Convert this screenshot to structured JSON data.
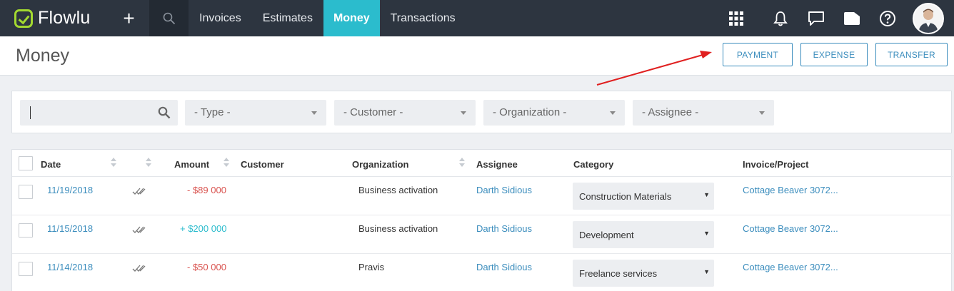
{
  "app": {
    "name": "Flowlu"
  },
  "nav": {
    "items": [
      {
        "label": "Invoices"
      },
      {
        "label": "Estimates"
      },
      {
        "label": "Money"
      },
      {
        "label": "Transactions"
      }
    ],
    "active": "Money"
  },
  "header": {
    "title": "Money",
    "buttons": {
      "payment": "PAYMENT",
      "expense": "EXPENSE",
      "transfer": "TRANSFER"
    }
  },
  "filters": {
    "search_value": "",
    "type": "- Type -",
    "customer": "- Customer -",
    "organization": "- Organization -",
    "assignee": "- Assignee -"
  },
  "table": {
    "columns": {
      "date": "Date",
      "amount": "Amount",
      "customer": "Customer",
      "organization": "Organization",
      "assignee": "Assignee",
      "category": "Category",
      "invoice": "Invoice/Project"
    },
    "rows": [
      {
        "date": "11/19/2018",
        "amount": "- $89 000",
        "direction": "out",
        "customer": "",
        "organization": "Business activation",
        "assignee": "Darth Sidious",
        "category": "Construction Materials",
        "invoice": "Cottage Beaver 3072..."
      },
      {
        "date": "11/15/2018",
        "amount": "+ $200 000",
        "direction": "in",
        "customer": "",
        "organization": "Business activation",
        "assignee": "Darth Sidious",
        "category": "Development",
        "invoice": "Cottage Beaver 3072..."
      },
      {
        "date": "11/14/2018",
        "amount": "- $50 000",
        "direction": "out",
        "customer": "",
        "organization": "Pravis",
        "assignee": "Darth Sidious",
        "category": "Freelance services",
        "invoice": "Cottage Beaver 3072..."
      }
    ]
  },
  "colors": {
    "topbar": "#2d3540",
    "active_tab": "#2bbccd",
    "logo": "#a3d930",
    "link": "#3b8dbd",
    "negative": "#d9534f",
    "positive": "#2bbccd",
    "annotation_arrow": "#e02020"
  },
  "icons": [
    "flowlu-logo-icon",
    "plus-icon",
    "search-icon",
    "apps-grid-icon",
    "bell-icon",
    "chat-icon",
    "folder-icon",
    "help-icon",
    "user-avatar",
    "double-check-icon",
    "sort-icon",
    "dropdown-arrow-icon"
  ]
}
